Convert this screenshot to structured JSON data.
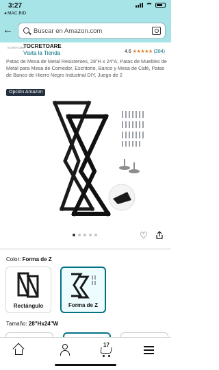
{
  "status_bar": {
    "time": "3:27",
    "back_app": "◂ MAC.BID"
  },
  "header": {
    "search_placeholder": "Buscar en Amazon.com"
  },
  "brand": {
    "logo_text": "TOCRETOARE",
    "name": "TOCRETOARE",
    "store_link": "Visita la Tienda",
    "rating_value": "4.6",
    "stars": "★★★★★",
    "rating_count": "(284)"
  },
  "product": {
    "title": "Patas de Mesa de Metal Resistentes, 28\"H x 24\"A, Patas de Muebles de Metal para Mesa de Comedor, Escritorio, Banco y Mesa de Café, Patas de Banco de Hierro Negro Industrial DIY, Juego de 2",
    "badge": "Opción Amazon",
    "image_count": 5,
    "active_image_index": 0
  },
  "color_selector": {
    "label": "Color:",
    "selected": "Forma de Z",
    "options": [
      {
        "label": "Rectángulo",
        "selected": false
      },
      {
        "label": "Forma de Z",
        "selected": true
      }
    ]
  },
  "size_selector": {
    "label": "Tamaño:",
    "selected": "28\"Hx24\"W"
  },
  "bottom_nav": {
    "cart_count": "17"
  },
  "colors": {
    "header_bg": "#a6e4e8",
    "link": "#007185",
    "star": "#de7921",
    "badge_bg": "#232f3e"
  }
}
